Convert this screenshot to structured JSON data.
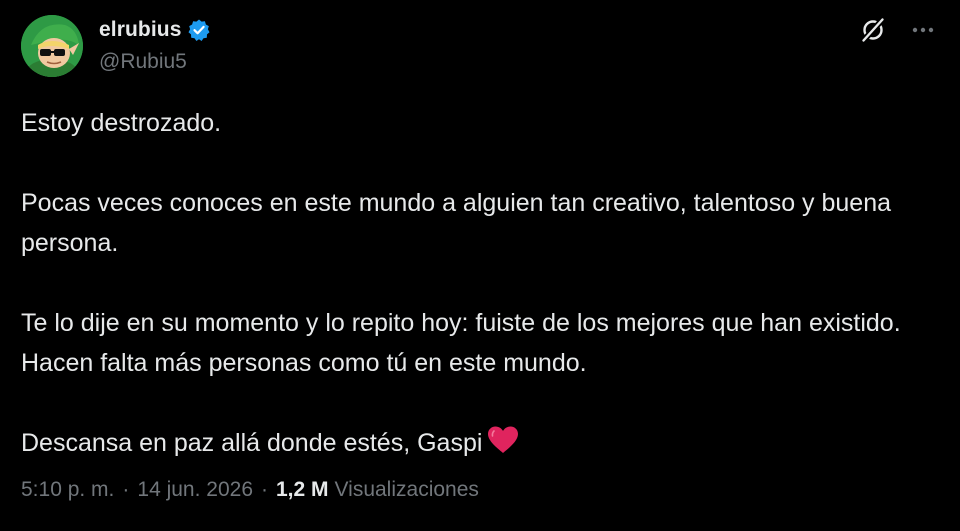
{
  "user": {
    "display_name": "elrubius",
    "handle": "@Rubiu5",
    "verified": true
  },
  "tweet": {
    "paragraphs": [
      "Estoy destrozado.",
      "Pocas veces conoces en este mundo a alguien tan creativo, talentoso y buena persona.",
      "Te lo dije en su momento y lo repito hoy: fuiste de los mejores que han existido. Hacen falta más personas como tú en este mundo.",
      "Descansa en paz allá donde estés, Gaspi"
    ],
    "emoji": "red-heart"
  },
  "meta": {
    "time": "5:10 p. m.",
    "separator": "·",
    "date": "14 jun. 2026",
    "views_count": "1,2 M",
    "views_label": "Visualizaciones"
  },
  "icons": {
    "verified": "verified-badge-icon",
    "grok": "grok-icon",
    "more": "more-icon"
  },
  "colors": {
    "background": "#000000",
    "text_primary": "#e7e9ea",
    "text_secondary": "#71767b",
    "verified_blue": "#1d9bf0",
    "heart_red": "#e0245e"
  }
}
